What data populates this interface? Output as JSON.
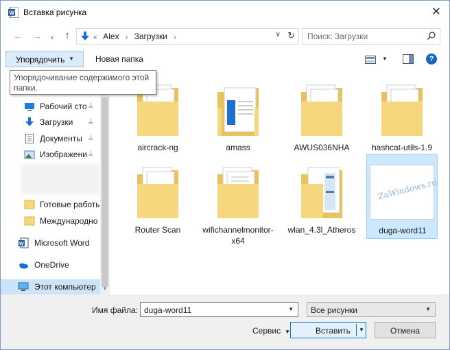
{
  "window": {
    "title": "Вставка рисунка",
    "close_glyph": "✕"
  },
  "nav": {
    "back_glyph": "←",
    "forward_glyph": "→",
    "up_glyph": "↑",
    "breadcrumbs": [
      "«",
      "Alex",
      "›",
      "Загрузки",
      "›"
    ],
    "search_placeholder": "Поиск: Загрузки"
  },
  "toolbar": {
    "organize_label": "Упорядочить",
    "new_folder_label": "Новая папка",
    "help_glyph": "?"
  },
  "tooltip": {
    "text": "Упорядочивание содержимого этой папки."
  },
  "sidebar": {
    "items": [
      {
        "label": "Рабочий сто",
        "icon": "desktop-icon",
        "pinned": true
      },
      {
        "label": "Загрузки",
        "icon": "download-icon",
        "pinned": true
      },
      {
        "label": "Документы",
        "icon": "documents-icon",
        "pinned": true
      },
      {
        "label": "Изображени",
        "icon": "pictures-icon",
        "pinned": true
      },
      {
        "label": "Готовые работы",
        "icon": "folder-icon",
        "pinned": false
      },
      {
        "label": "Международно",
        "icon": "folder-icon",
        "pinned": false
      },
      {
        "label": "Microsoft Word",
        "icon": "word-icon",
        "pinned": false
      },
      {
        "label": "OneDrive",
        "icon": "onedrive-icon",
        "pinned": false
      },
      {
        "label": "Этот компьютер",
        "icon": "computer-icon",
        "pinned": false
      }
    ],
    "pin_glyph": "📌"
  },
  "files": [
    {
      "name": "aircrack-ng",
      "type": "folder"
    },
    {
      "name": "amass",
      "type": "folder"
    },
    {
      "name": "AWUS036NHA",
      "type": "folder"
    },
    {
      "name": "hashcat-utils-1.9",
      "type": "folder"
    },
    {
      "name": "Router Scan",
      "type": "folder"
    },
    {
      "name": "wifichannelmonitor-x64",
      "type": "folder"
    },
    {
      "name": "wlan_4.3l_Atheros",
      "type": "folder"
    },
    {
      "name": "duga-word11",
      "type": "image",
      "selected": true,
      "watermark": "ZaWindows.ru"
    }
  ],
  "bottom": {
    "filename_label": "Имя файла:",
    "filename_value": "duga-word11",
    "filetype_value": "Все рисунки",
    "tools_label": "Сервис",
    "insert_label": "Вставить",
    "cancel_label": "Отмена"
  },
  "colors": {
    "accent": "#0078d7",
    "selection": "#cce8ff",
    "folder": "#f6d77e"
  }
}
